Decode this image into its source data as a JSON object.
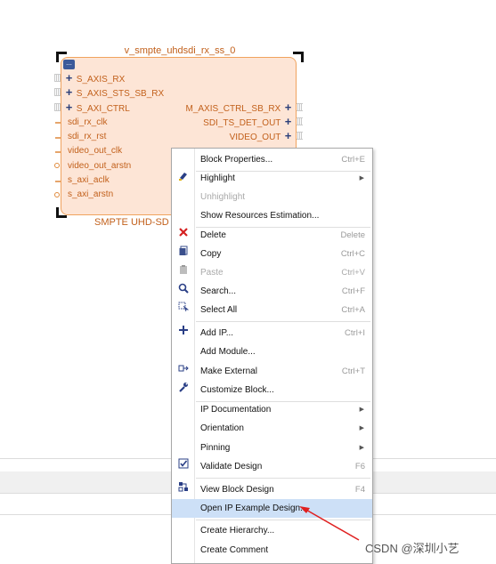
{
  "instance_name": "v_smpte_uhdsdi_rx_ss_0",
  "block_name": "SMPTE UHD-SD",
  "block_icon": "...",
  "ports_left": [
    {
      "label": "S_AXIS_RX",
      "kind": "bus"
    },
    {
      "label": "S_AXIS_STS_SB_RX",
      "kind": "bus"
    },
    {
      "label": "S_AXI_CTRL",
      "kind": "bus"
    },
    {
      "label": "sdi_rx_clk",
      "kind": "signal"
    },
    {
      "label": "sdi_rx_rst",
      "kind": "signal"
    },
    {
      "label": "video_out_clk",
      "kind": "signal"
    },
    {
      "label": "video_out_arstn",
      "kind": "signal"
    },
    {
      "label": "s_axi_aclk",
      "kind": "signal"
    },
    {
      "label": "s_axi_arstn",
      "kind": "signal"
    }
  ],
  "ports_right": [
    {
      "label": "M_AXIS_CTRL_SB_RX",
      "kind": "bus"
    },
    {
      "label": "SDI_TS_DET_OUT",
      "kind": "bus"
    },
    {
      "label": "VIDEO_OUT",
      "kind": "bus"
    }
  ],
  "menu": {
    "items": [
      {
        "label": "Block Properties...",
        "shortcut": "Ctrl+E",
        "icon": "",
        "disabled": false,
        "submenu": false
      },
      {
        "label": "Highlight",
        "shortcut": "",
        "icon": "highlight-icon",
        "disabled": false,
        "submenu": true
      },
      {
        "label": "Unhighlight",
        "shortcut": "",
        "icon": "",
        "disabled": true,
        "submenu": false
      },
      {
        "label": "Show Resources Estimation...",
        "shortcut": "",
        "icon": "",
        "disabled": false,
        "submenu": false
      },
      {
        "label": "Delete",
        "shortcut": "Delete",
        "icon": "delete-icon",
        "disabled": false,
        "submenu": false
      },
      {
        "label": "Copy",
        "shortcut": "Ctrl+C",
        "icon": "copy-icon",
        "disabled": false,
        "submenu": false
      },
      {
        "label": "Paste",
        "shortcut": "Ctrl+V",
        "icon": "paste-icon",
        "disabled": true,
        "submenu": false
      },
      {
        "label": "Search...",
        "shortcut": "Ctrl+F",
        "icon": "search-icon",
        "disabled": false,
        "submenu": false
      },
      {
        "label": "Select All",
        "shortcut": "Ctrl+A",
        "icon": "select-all-icon",
        "disabled": false,
        "submenu": false
      },
      {
        "label": "Add IP...",
        "shortcut": "Ctrl+I",
        "icon": "add-icon",
        "disabled": false,
        "submenu": false
      },
      {
        "label": "Add Module...",
        "shortcut": "",
        "icon": "",
        "disabled": false,
        "submenu": false
      },
      {
        "label": "Make External",
        "shortcut": "Ctrl+T",
        "icon": "make-external-icon",
        "disabled": false,
        "submenu": false
      },
      {
        "label": "Customize Block...",
        "shortcut": "",
        "icon": "wrench-icon",
        "disabled": false,
        "submenu": false
      },
      {
        "label": "IP Documentation",
        "shortcut": "",
        "icon": "",
        "disabled": false,
        "submenu": true
      },
      {
        "label": "Orientation",
        "shortcut": "",
        "icon": "",
        "disabled": false,
        "submenu": true
      },
      {
        "label": "Pinning",
        "shortcut": "",
        "icon": "",
        "disabled": false,
        "submenu": true
      },
      {
        "label": "Validate Design",
        "shortcut": "F6",
        "icon": "validate-icon",
        "disabled": false,
        "submenu": false
      },
      {
        "label": "View Block Design",
        "shortcut": "F4",
        "icon": "view-block-icon",
        "disabled": false,
        "submenu": false
      },
      {
        "label": "Open IP Example Design...",
        "shortcut": "",
        "icon": "",
        "disabled": false,
        "submenu": false,
        "highlighted": true
      },
      {
        "label": "Create Hierarchy...",
        "shortcut": "",
        "icon": "",
        "disabled": false,
        "submenu": false
      },
      {
        "label": "Create Comment",
        "shortcut": "",
        "icon": "",
        "disabled": false,
        "submenu": false
      }
    ]
  },
  "watermark": "CSDN @深圳小艺",
  "colors": {
    "block_fill": "#fde5d6",
    "block_border": "#f0a35e",
    "port_text": "#c2601b",
    "menu_highlight": "#cde0f7",
    "arrow": "#e02020"
  }
}
